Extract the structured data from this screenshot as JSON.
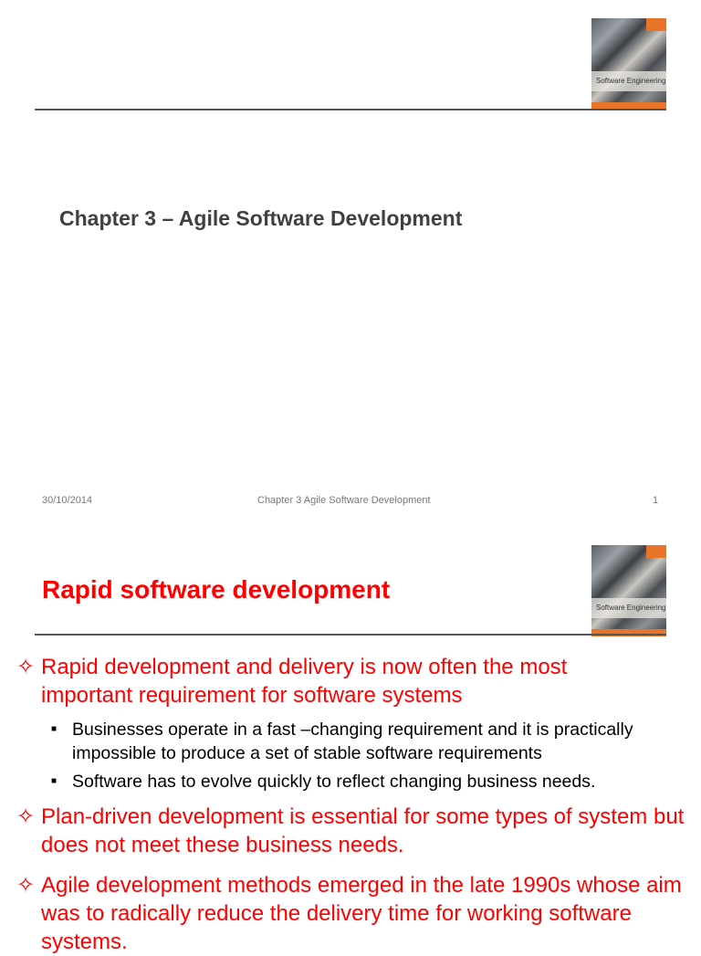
{
  "slide1": {
    "cover_title": "Software Engineering",
    "title": "Chapter 3 – Agile Software Development",
    "footer": {
      "date": "30/10/2014",
      "center": "Chapter 3 Agile Software Development",
      "page": "1"
    }
  },
  "slide2": {
    "cover_title": "Software Engineering",
    "title": "Rapid software development",
    "bullets": [
      {
        "text": "Rapid development and delivery is now often the most important requirement for software systems",
        "sub": [
          "Businesses operate in a fast –changing requirement and it is practically impossible to produce a set of stable software requirements",
          "Software has to evolve quickly to reflect changing business needs."
        ]
      },
      {
        "text": "Plan-driven development is essential for some types of system but does not meet these business needs."
      },
      {
        "text": "Agile development methods emerged in the late 1990s whose aim was to radically reduce the delivery time for working software systems."
      }
    ]
  }
}
